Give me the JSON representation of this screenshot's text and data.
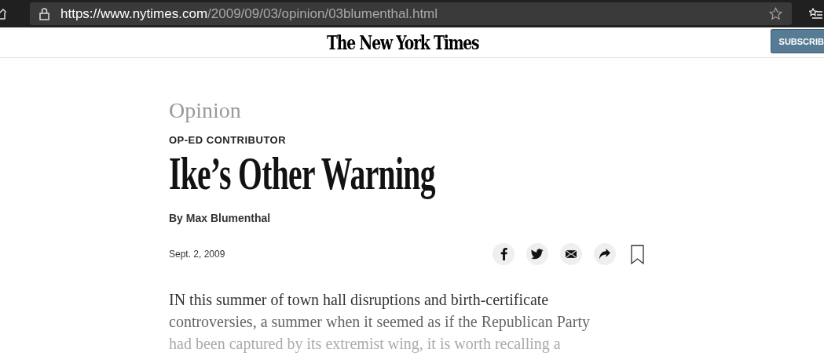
{
  "browser": {
    "url_host": "https://www.nytimes.com",
    "url_path": "/2009/09/03/opinion/03blumenthal.html"
  },
  "header": {
    "logo": "The New York Times",
    "subscribe_button": "SUBSCRIB"
  },
  "article": {
    "section": "Opinion",
    "kicker": "OP-ED CONTRIBUTOR",
    "headline": "Ike’s Other Warning",
    "byline": "By Max Blumenthal",
    "date": "Sept. 2, 2009",
    "share": [
      {
        "kind": "facebook"
      },
      {
        "kind": "twitter"
      },
      {
        "kind": "email"
      },
      {
        "kind": "share"
      },
      {
        "kind": "bookmark"
      }
    ],
    "body_lines": [
      "IN this summer of town hall disruptions and birth-certificate",
      "controversies, a summer when it seemed as if the Republican Party",
      "had been captured by its extremist wing, it is worth recalling a"
    ]
  }
}
